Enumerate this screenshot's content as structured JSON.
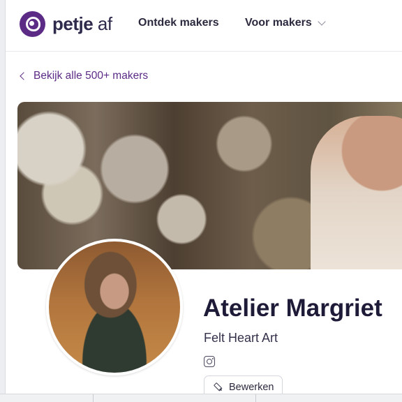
{
  "brand": {
    "logo_text": "petje",
    "logo_suffix": "af",
    "accent": "#5b2b86"
  },
  "nav": [
    {
      "label": "Ontdek makers"
    },
    {
      "label": "Voor makers"
    }
  ],
  "back_link": {
    "label": "Bekijk alle 500+ makers"
  },
  "profile": {
    "name": "Atelier Margriet",
    "subtitle": "Felt Heart Art",
    "social_icon": "instagram-icon"
  },
  "actions": {
    "edit_label": "Bewerken"
  }
}
